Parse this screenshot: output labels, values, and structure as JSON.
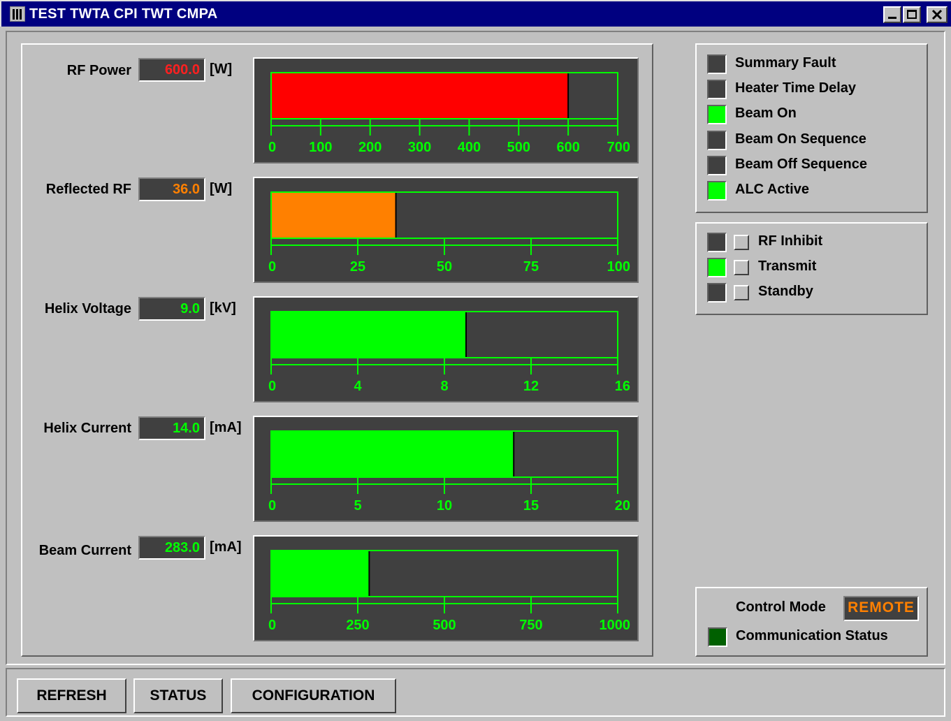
{
  "window": {
    "title": "TEST TWTA CPI TWT CMPA"
  },
  "meters": [
    {
      "label": "RF Power",
      "value": "600.0",
      "unit": "[W]",
      "color": "#ff0000",
      "value_color": "#ff2020",
      "reading": 600,
      "max": 700,
      "ticks": [
        "0",
        "100",
        "200",
        "300",
        "400",
        "500",
        "600",
        "700"
      ]
    },
    {
      "label": "Reflected RF",
      "value": "36.0",
      "unit": "[W]",
      "color": "#ff8000",
      "value_color": "#ff8000",
      "reading": 36,
      "max": 100,
      "ticks": [
        "0",
        "25",
        "50",
        "75",
        "100"
      ]
    },
    {
      "label": "Helix Voltage",
      "value": "9.0",
      "unit": "[kV]",
      "color": "#00ff00",
      "value_color": "#00ff00",
      "reading": 9,
      "max": 16,
      "ticks": [
        "0",
        "4",
        "8",
        "12",
        "16"
      ]
    },
    {
      "label": "Helix Current",
      "value": "14.0",
      "unit": "[mA]",
      "color": "#00ff00",
      "value_color": "#00ff00",
      "reading": 14,
      "max": 20,
      "ticks": [
        "0",
        "5",
        "10",
        "15",
        "20"
      ]
    },
    {
      "label": "Beam Current",
      "value": "283.0",
      "unit": "[mA]",
      "color": "#00ff00",
      "value_color": "#00ff00",
      "reading": 283,
      "max": 1000,
      "ticks": [
        "0",
        "250",
        "500",
        "750",
        "1000"
      ]
    }
  ],
  "status_indicators": [
    {
      "label": "Summary Fault",
      "state": "off"
    },
    {
      "label": "Heater Time Delay",
      "state": "off"
    },
    {
      "label": "Beam On",
      "state": "on"
    },
    {
      "label": "Beam On Sequence",
      "state": "off"
    },
    {
      "label": "Beam Off Sequence",
      "state": "off"
    },
    {
      "label": "ALC Active",
      "state": "on"
    }
  ],
  "controls": [
    {
      "label": "RF Inhibit",
      "state": "off"
    },
    {
      "label": "Transmit",
      "state": "on"
    },
    {
      "label": "Standby",
      "state": "off"
    }
  ],
  "control_mode": {
    "label": "Control Mode",
    "value": "REMOTE",
    "comm_label": "Communication Status",
    "comm_state": "dark"
  },
  "buttons": {
    "refresh": "REFRESH",
    "status": "STATUS",
    "configuration": "CONFIGURATION"
  },
  "colors": {
    "scale": "#00ff00",
    "gauge_bg": "#404040",
    "led_on": "#00ff00",
    "led_off": "#404040",
    "comm_led": "#006000",
    "mode_text": "#ff8000"
  }
}
